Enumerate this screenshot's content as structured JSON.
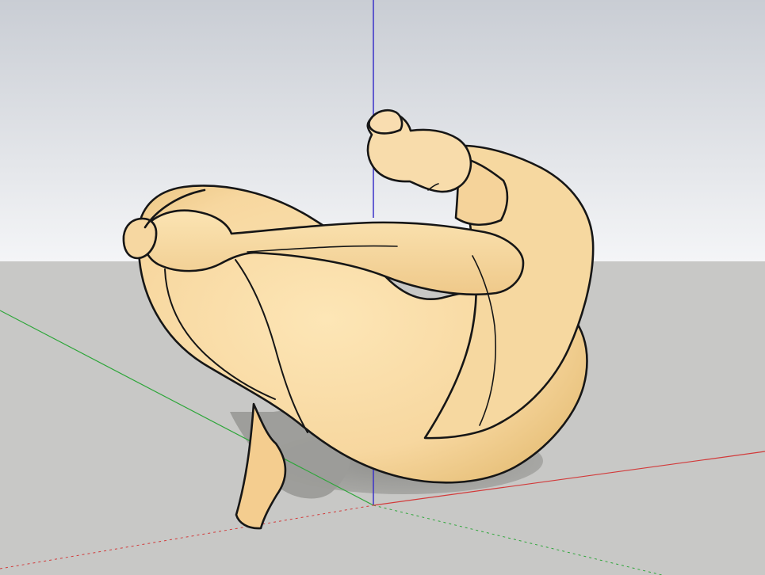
{
  "viewport": {
    "scene": {
      "object": "figure-model",
      "axes": [
        "blue-axis",
        "green-axis",
        "red-axis"
      ]
    },
    "colors": {
      "sky_top": "#c8ccd3",
      "sky_bottom": "#f3f4f6",
      "ground": "#c8c8c6",
      "figure_fill": "#f7d9a0",
      "figure_shade": "#e7bf76",
      "figure_outline": "#161616",
      "shadow": "#9d9d9a",
      "axis_blue": "#3b32c8",
      "axis_green": "#2ea63a",
      "axis_red": "#d23a3a"
    }
  }
}
